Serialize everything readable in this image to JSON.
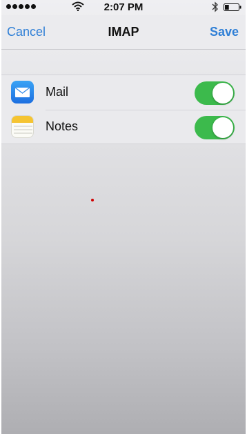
{
  "status_bar": {
    "time": "2:07 PM",
    "signal_icon": "signal-dots-icon",
    "wifi_icon": "wifi-icon",
    "bluetooth_icon": "bluetooth-icon",
    "battery_icon": "battery-icon",
    "battery_level": 0.3
  },
  "nav": {
    "cancel_label": "Cancel",
    "title": "IMAP",
    "save_label": "Save"
  },
  "settings": [
    {
      "label": "Mail",
      "icon": "mail-app-icon",
      "enabled": true
    },
    {
      "label": "Notes",
      "icon": "notes-app-icon",
      "enabled": true
    }
  ],
  "colors": {
    "accent": "#2f7fd6",
    "toggle_on": "#3cba4c"
  }
}
